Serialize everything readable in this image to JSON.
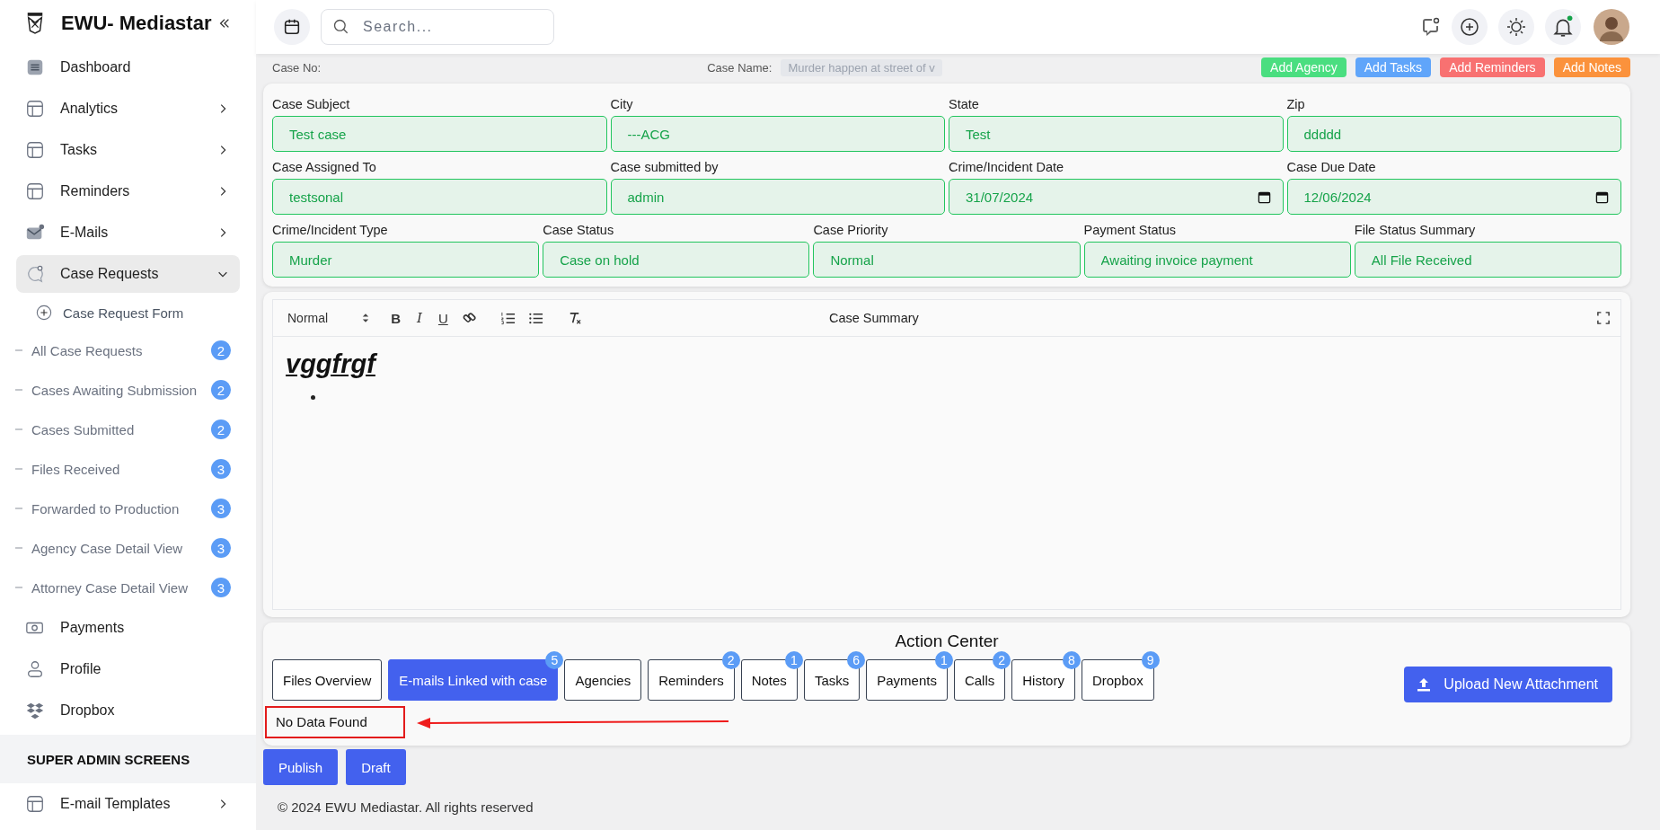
{
  "sidebar": {
    "brand": "EWU- Mediastar",
    "items": [
      {
        "kind": "nav",
        "label": "Dashboard",
        "selected": false
      },
      {
        "kind": "nav",
        "label": "Analytics",
        "selected": false,
        "expanded": false
      },
      {
        "kind": "nav",
        "label": "Tasks",
        "selected": false,
        "expanded": false
      },
      {
        "kind": "nav",
        "label": "Reminders",
        "selected": false,
        "expanded": false
      },
      {
        "kind": "nav",
        "label": "E-Mails",
        "selected": false,
        "expanded": false
      },
      {
        "kind": "nav",
        "label": "Case Requests",
        "selected": true,
        "expanded": true,
        "children": [
          {
            "kind": "sub",
            "label": "Case Request Form"
          },
          {
            "kind": "count",
            "label": "All Case Requests",
            "count": "2"
          },
          {
            "kind": "count",
            "label": "Cases Awaiting Submission",
            "count": "2"
          },
          {
            "kind": "count",
            "label": "Cases Submitted",
            "count": "2"
          },
          {
            "kind": "count",
            "label": "Files Received",
            "count": "3"
          },
          {
            "kind": "count",
            "label": "Forwarded to Production",
            "count": "3"
          },
          {
            "kind": "count",
            "label": "Agency Case Detail View",
            "count": "3"
          },
          {
            "kind": "count",
            "label": "Attorney Case Detail View",
            "count": "3"
          }
        ]
      },
      {
        "kind": "nav",
        "label": "Payments",
        "selected": false
      },
      {
        "kind": "nav",
        "label": "Profile",
        "selected": false
      },
      {
        "kind": "nav",
        "label": "Dropbox",
        "selected": false
      },
      {
        "kind": "section",
        "label": "SUPER ADMIN SCREENS"
      },
      {
        "kind": "nav",
        "label": "E-mail Templates",
        "selected": false,
        "expanded": false
      }
    ]
  },
  "header": {
    "search": {
      "placeholder": "Search..."
    }
  },
  "case_header": {
    "case_no_label": "Case No:",
    "case_name_label": "Case Name:",
    "case_name_value": "Murder happen at street of v",
    "actions": [
      {
        "label": "Add Agency",
        "color": "#4ade80"
      },
      {
        "label": "Add Tasks",
        "color": "#60a5fa"
      },
      {
        "label": "Add Reminders",
        "color": "#f87171"
      },
      {
        "label": "Add Notes",
        "color": "#fb923c"
      }
    ]
  },
  "form": {
    "rows": [
      [
        {
          "kind": "text",
          "label": "Case Subject",
          "value": "Test case"
        },
        {
          "kind": "text",
          "label": "City",
          "value": "---ACG"
        },
        {
          "kind": "text",
          "label": "State",
          "value": "Test"
        },
        {
          "kind": "text",
          "label": "Zip",
          "value": "ddddd"
        }
      ],
      [
        {
          "kind": "text",
          "label": "Case Assigned To",
          "value": "testsonal"
        },
        {
          "kind": "text",
          "label": "Case submitted by",
          "value": "admin"
        },
        {
          "kind": "date",
          "label": "Crime/Incident Date",
          "value": "31/07/2024"
        },
        {
          "kind": "date",
          "label": "Case Due Date",
          "value": "12/06/2024"
        }
      ],
      [
        {
          "kind": "text",
          "label": "Crime/Incident Type",
          "value": "Murder"
        },
        {
          "kind": "text",
          "label": "Case Status",
          "value": "Case on hold"
        },
        {
          "kind": "text",
          "label": "Case Priority",
          "value": "Normal"
        },
        {
          "kind": "text",
          "label": "Payment Status",
          "value": "Awaiting invoice payment"
        },
        {
          "kind": "text",
          "label": "File Status Summary",
          "value": "All File Received"
        }
      ]
    ]
  },
  "editor": {
    "title": "Case Summary",
    "format": "Normal",
    "format_buttons": [
      "B",
      "I",
      "U"
    ],
    "content": "vggfrgf"
  },
  "action_center": {
    "title": "Action Center",
    "tabs": [
      {
        "label": "Files Overview",
        "selected": false
      },
      {
        "label": "E-mails Linked with case",
        "badge": "5",
        "selected": true
      },
      {
        "label": "Agencies",
        "selected": false
      },
      {
        "label": "Reminders",
        "badge": "2",
        "selected": false
      },
      {
        "label": "Notes",
        "badge": "1",
        "selected": false
      },
      {
        "label": "Tasks",
        "badge": "6",
        "selected": false
      },
      {
        "label": "Payments",
        "badge": "1",
        "selected": false
      },
      {
        "label": "Calls",
        "badge": "2",
        "selected": false
      },
      {
        "label": "History",
        "badge": "8",
        "selected": false
      },
      {
        "label": "Dropbox",
        "badge": "9",
        "selected": false
      }
    ],
    "upload_button": "Upload New Attachment",
    "message": "No Data Found"
  },
  "buttons": [
    "Publish",
    "Draft"
  ],
  "footer": "© 2024 EWU Mediastar. All rights reserved"
}
